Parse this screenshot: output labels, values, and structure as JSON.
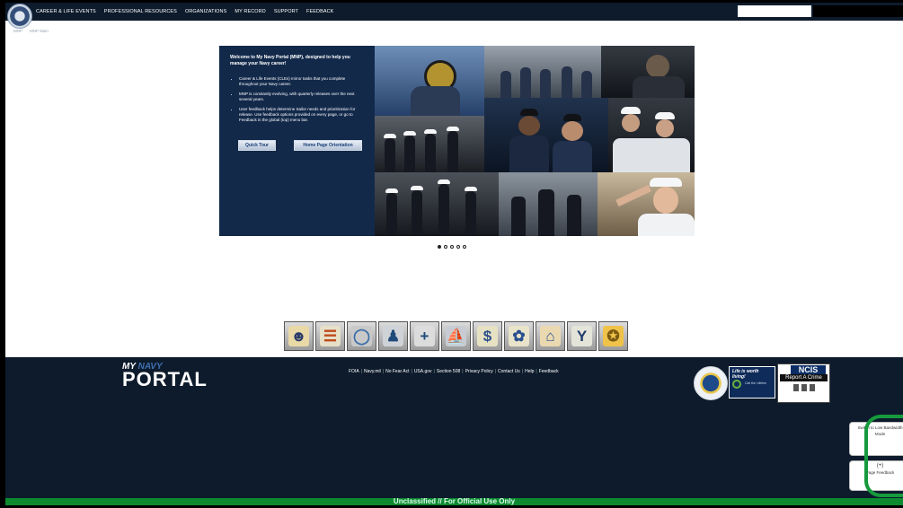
{
  "nav": {
    "items": [
      "CAREER & LIFE EVENTS",
      "PROFESSIONAL RESOURCES",
      "ORGANIZATIONS",
      "MY RECORD",
      "SUPPORT",
      "FEEDBACK"
    ],
    "search_value": ""
  },
  "breadcrumb": [
    "MNP",
    "MNP Main"
  ],
  "hero": {
    "title": "Welcome to My Navy Portal (MNP), designed to help you manage your Navy career!",
    "bullets": [
      "Career & Life Events (CLEs) mirror tasks that you complete throughout your Navy career.",
      "MNP is constantly evolving, with quarterly releases over the next several years.",
      "User feedback helps determine Sailor needs and prioritization for release. Use feedback options provided on every page, or go to Feedback in the global (top) menu bar."
    ],
    "buttons": {
      "quick_tour": "Quick Tour",
      "orientation": "Home Page Orientation"
    },
    "slides_total": 5,
    "slide_active": 1
  },
  "quick_links_icons": [
    "sailor-icon",
    "ladder-icon",
    "globe-icon",
    "person-icon",
    "medical-cross-icon",
    "ship-icon",
    "dollar-icon",
    "runner-icon",
    "family-house-icon",
    "branch-arrow-icon",
    "certificate-icon"
  ],
  "footer": {
    "logo": {
      "my": "MY",
      "navy": "NAVY",
      "portal": "PORTAL"
    },
    "links": [
      "FOIA",
      "Navy.mil",
      "No Fear Act",
      "USA.gov",
      "Section 508",
      "Privacy Policy",
      "Contact Us",
      "Help",
      "Feedback"
    ],
    "badge_lifeline": {
      "title": "Life is worth living!",
      "subtitle": "Call the Lifeline"
    },
    "ncis": {
      "title": "NCIS",
      "subtitle": "Report A Crime"
    }
  },
  "side": {
    "low_bandwidth": "Switch to Low Bandwidth Mode",
    "page_feedback_plus": "(+)",
    "page_feedback": "Page Feedback"
  },
  "classification": "Unclassified // For Official Use Only",
  "colors": {
    "nav_bg": "#0d1b2c",
    "hero_panel": "#12294a",
    "classification_bar": "#0c8a30",
    "highlight_ring": "#169a3c"
  }
}
